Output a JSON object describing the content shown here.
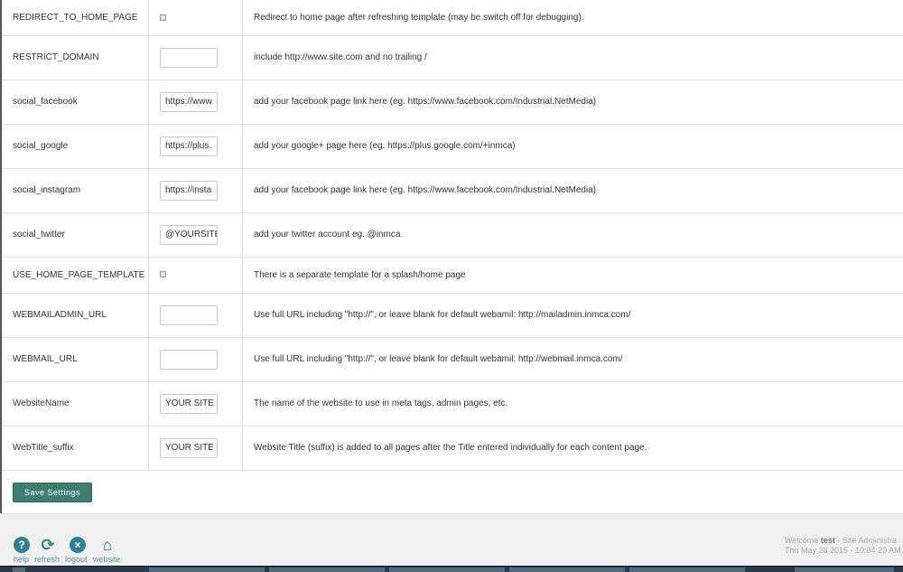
{
  "rows": [
    {
      "key": "REDIRECT_TO_HOME_PAGE",
      "desc": "Redirect to home page after refreshing template (may be switch off for debugging)."
    },
    {
      "key": "RESTRICT_DOMAIN",
      "value": "",
      "desc": "include http://www.site.com and no trailing /"
    },
    {
      "key": "social_facebook",
      "value": "https://www",
      "desc": "add your facebook page link here (eg. https://www.facebook.com/Industrial.NetMedia)"
    },
    {
      "key": "social_google",
      "value": "https://plus.",
      "desc": "add your google+ page here (eg. https://plus.google.com/+inmca)"
    },
    {
      "key": "social_instagram",
      "value": "https://insta",
      "desc": "add your facebook page link here (eg. https://www.facebook.com/Industrial.NetMedia)"
    },
    {
      "key": "social_twitter",
      "value": "@YOURSITE",
      "desc": "add your twitter account eg. @inmca"
    },
    {
      "key": "USE_HOME_PAGE_TEMPLATE",
      "desc": "There is a separate template for a splash/home page"
    },
    {
      "key": "WEBMAILADMIN_URL",
      "value": "",
      "desc": "Use full URL including \"http://\", or leave blank for default webamil: http://mailadmin.inmca.com/"
    },
    {
      "key": "WEBMAIL_URL",
      "value": "",
      "desc": "Use full URL including \"http://\", or leave blank for default webamil: http://webmail.inmca.com/"
    },
    {
      "key": "WebsiteName",
      "value": "YOUR SITE",
      "desc": "The name of the website to use in meta tags, admin pages, etc."
    },
    {
      "key": "WebTitle_suffix",
      "value": "YOUR SITE",
      "desc": "Website Title (suffix) is added to all pages after the Title entered individually for each content page."
    }
  ],
  "save_label": "Save Settings",
  "footer": {
    "help": "help",
    "refresh": "refresh",
    "logout": "logout",
    "website": "website",
    "welcome_prefix": "Welcome ",
    "user": "test",
    "role": " - Site Administra",
    "datetime": "Thu May 28 2015 - 10:04:20 AM"
  },
  "colors": {
    "button": "#3e7d72",
    "icon": "#2e8297"
  },
  "icons": {
    "help": "question-icon",
    "refresh": "refresh-icon",
    "logout": "close-circle-icon",
    "website": "home-icon"
  }
}
